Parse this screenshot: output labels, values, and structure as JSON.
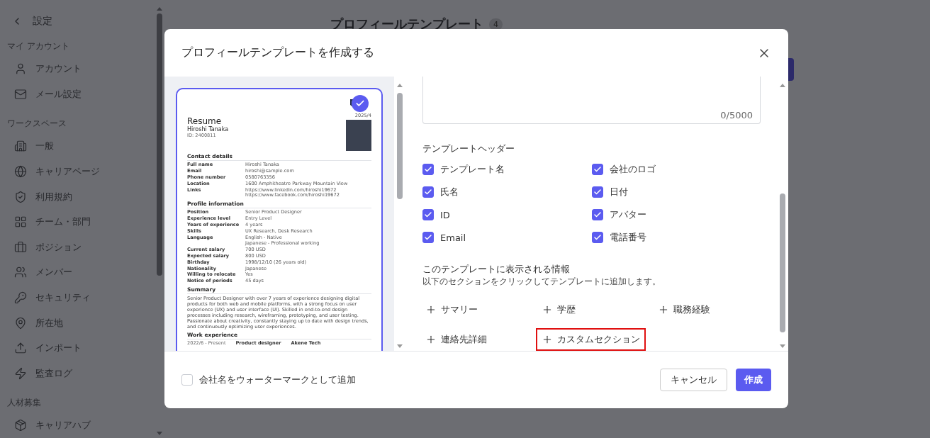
{
  "sidebar": {
    "back_label": "設定",
    "groups": [
      {
        "heading": "マイ アカウント",
        "items": [
          {
            "label": "アカウント"
          },
          {
            "label": "メール設定"
          }
        ]
      },
      {
        "heading": "ワークスペース",
        "items": [
          {
            "label": "一般"
          },
          {
            "label": "キャリアページ"
          },
          {
            "label": "利用規約"
          },
          {
            "label": "チーム・部門"
          },
          {
            "label": "ポジション"
          },
          {
            "label": "メンバー"
          },
          {
            "label": "セキュリティ"
          },
          {
            "label": "所在地"
          },
          {
            "label": "インポート"
          },
          {
            "label": "監査ログ"
          }
        ]
      },
      {
        "heading": "人材募集",
        "items": [
          {
            "label": "キャリアハブ"
          }
        ]
      }
    ]
  },
  "page": {
    "title": "プロフィールテンプレート",
    "count": "4"
  },
  "dialog": {
    "title": "プロフィールテンプレートを作成する",
    "preview": {
      "selected": true,
      "date": "2025/4",
      "heading": "Resume",
      "name": "Hiroshi Tanaka",
      "id": "ID: 2400811",
      "sections": [
        {
          "kind": "fields",
          "title": "Contact details",
          "rows": [
            {
              "label": "Full name",
              "values": [
                "Hiroshi Tanaka"
              ]
            },
            {
              "label": "Email",
              "values": [
                "hiroshi@sample.com"
              ]
            },
            {
              "label": "Phone number",
              "values": [
                "0580763356"
              ]
            },
            {
              "label": "Location",
              "values": [
                "1600 Amphitheatre Parkway Mountain View"
              ]
            },
            {
              "label": "Links",
              "values": [
                "https://www.linkedin.com/hiroshi19672",
                "https://www.facebook.com/hiroshi19672"
              ]
            }
          ]
        },
        {
          "kind": "fields",
          "title": "Profile information",
          "rows": [
            {
              "label": "Position",
              "values": [
                "Senior Product Designer"
              ]
            },
            {
              "label": "Experience level",
              "values": [
                "Entry Level"
              ]
            },
            {
              "label": "Years of experience",
              "values": [
                "4 years"
              ]
            },
            {
              "label": "Skills",
              "values": [
                "UX Research, Desk Research"
              ]
            },
            {
              "label": "Language",
              "values": [
                "English - Native",
                "Japanese - Professional working"
              ]
            },
            {
              "label": "Current salary",
              "values": [
                "700 USD"
              ]
            },
            {
              "label": "Expected salary",
              "values": [
                "800 USD"
              ]
            },
            {
              "label": "Birthday",
              "values": [
                "1998/12/10 (26 years old)"
              ]
            },
            {
              "label": "Nationality",
              "values": [
                "Japanese"
              ]
            },
            {
              "label": "Willing to relocate",
              "values": [
                "Yes"
              ]
            },
            {
              "label": "Notice of periods",
              "values": [
                "45 days"
              ]
            }
          ]
        },
        {
          "kind": "text",
          "title": "Summary",
          "text": "Senior Product Designer with over 7 years of experience designing digital products for both web and mobile platforms, with a strong focus on user experience (UX) and user interface (UI). Skilled in end-to-end design processes including research, wireframing, prototyping, and user testing. Passionate about creativity, constantly staying up to date with design trends, and continuously optimizing user experiences."
        },
        {
          "kind": "work",
          "title": "Work experience",
          "period": "2022/6 - Present",
          "role": "Product designer",
          "company": "Akene Tech"
        }
      ]
    },
    "description_counter": "0/5000",
    "header_section": {
      "title": "テンプレートヘッダー",
      "options": [
        {
          "label": "テンプレート名",
          "checked": true
        },
        {
          "label": "会社のロゴ",
          "checked": true
        },
        {
          "label": "氏名",
          "checked": true
        },
        {
          "label": "日付",
          "checked": true
        },
        {
          "label": "ID",
          "checked": true
        },
        {
          "label": "アバター",
          "checked": true
        },
        {
          "label": "Email",
          "checked": true
        },
        {
          "label": "電話番号",
          "checked": true
        }
      ]
    },
    "info_section": {
      "title": "このテンプレートに表示される情報",
      "hint": "以下のセクションをクリックしてテンプレートに追加します。",
      "sections": [
        {
          "label": "サマリー",
          "highlighted": false
        },
        {
          "label": "学歴",
          "highlighted": false
        },
        {
          "label": "職務経験",
          "highlighted": false
        },
        {
          "label": "連絡先詳細",
          "highlighted": false
        },
        {
          "label": "カスタムセクション",
          "highlighted": true
        }
      ]
    },
    "watermark": {
      "label": "会社名をウォーターマークとして追加",
      "checked": false
    },
    "buttons": {
      "cancel": "キャンセル",
      "create": "作成"
    }
  }
}
